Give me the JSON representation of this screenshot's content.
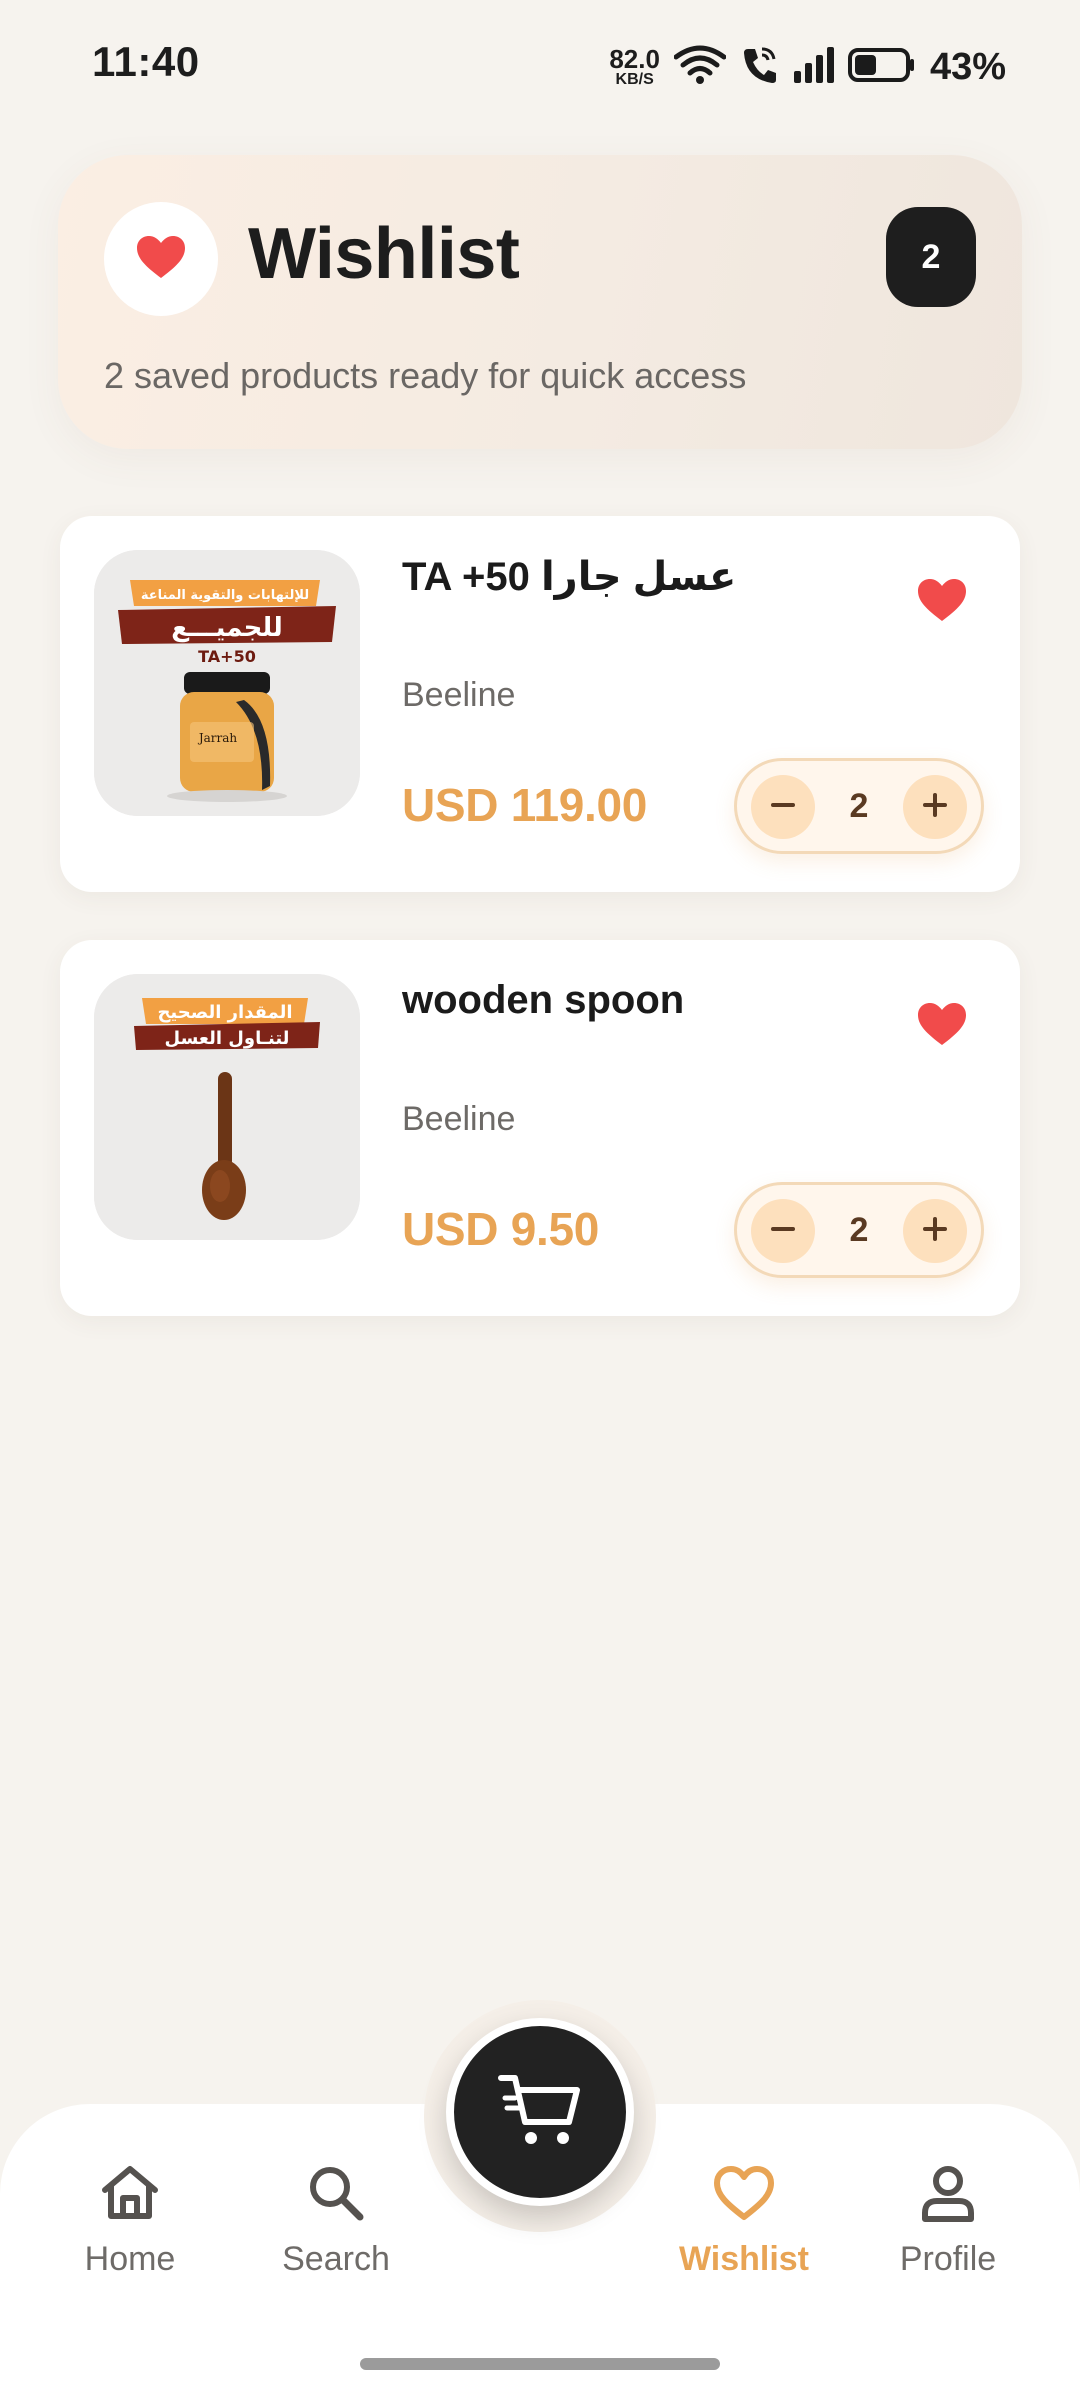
{
  "status_bar": {
    "time": "11:40",
    "net_speed_value": "82.0",
    "net_speed_unit": "KB/S",
    "battery_percent": "43%",
    "battery_level": 0.43
  },
  "header": {
    "icon": "heart-icon",
    "title": "Wishlist",
    "count": "2",
    "subtitle": "2 saved products ready for quick access"
  },
  "products": [
    {
      "name": "TA +50 عسل جارا",
      "brand": "Beeline",
      "price": "USD 119.00",
      "quantity": "2",
      "thumb_texts": {
        "line1": "للإلتهابات والتقوية المناعة",
        "line2": "للجميـــع",
        "line3": "TA+50",
        "jar_label": "Jarrah"
      }
    },
    {
      "name": "wooden spoon",
      "brand": "Beeline",
      "price": "USD 9.50",
      "quantity": "2",
      "thumb_texts": {
        "line1": "المقدار الصحيح",
        "line2": "لتنـاول العسل"
      }
    }
  ],
  "bottom_nav": {
    "items": [
      {
        "label": "Home",
        "icon": "home-icon"
      },
      {
        "label": "Search",
        "icon": "search-icon"
      },
      {
        "label": "Wishlist",
        "icon": "heart-outline-icon",
        "active": true
      },
      {
        "label": "Profile",
        "icon": "profile-icon"
      }
    ],
    "cart_icon": "cart-icon"
  },
  "colors": {
    "accent": "#e8a455",
    "heart": "#f14b4b",
    "background": "#f6f3ee",
    "dark": "#1e1e1e"
  }
}
